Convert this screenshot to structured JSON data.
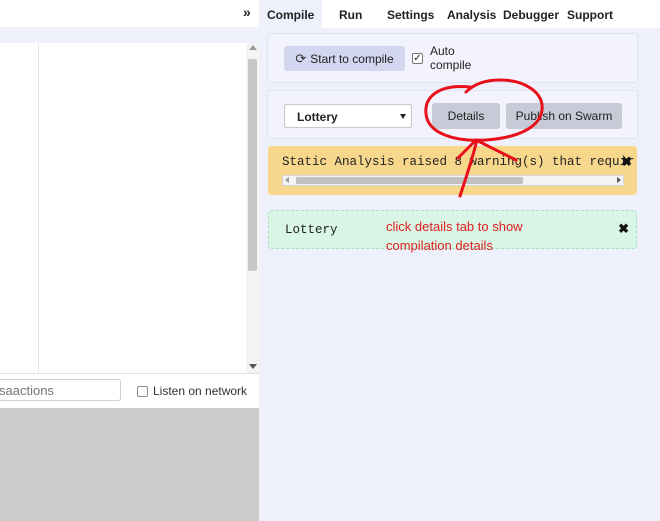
{
  "left": {
    "collapse_icon": "double-chevron-right-icon",
    "collapse_glyph": "»",
    "search": {
      "value": "",
      "placeholder": "saactions"
    },
    "listen_label": "Listen on network"
  },
  "tabs": [
    {
      "label": "Compile",
      "active": true
    },
    {
      "label": "Run"
    },
    {
      "label": "Settings"
    },
    {
      "label": "Analysis"
    },
    {
      "label": "Debugger"
    },
    {
      "label": "Support"
    }
  ],
  "compile": {
    "start_button": "Start to compile",
    "start_icon": "refresh-icon",
    "auto_compile_label_line1": "Auto",
    "auto_compile_label_line2": "compile",
    "auto_compile_checked": true
  },
  "contract": {
    "selected": "Lottery",
    "details_button": "Details",
    "publish_button": "Publish on Swarm"
  },
  "warning": {
    "text": "Static Analysis raised 8 warning(s) that requir",
    "close_glyph": "✖",
    "color": "#f7d78c"
  },
  "success": {
    "name": "Lottery",
    "close_glyph": "✖",
    "color": "#d9f5e6"
  },
  "annotation": {
    "line1": "click details tab to show",
    "line2": "compilation details",
    "color": "#e02020"
  }
}
